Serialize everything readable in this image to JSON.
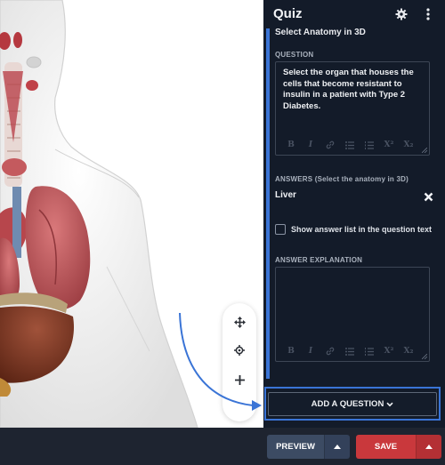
{
  "panel": {
    "title": "Quiz",
    "card_heading": "Select Anatomy in 3D",
    "question_label": "QUESTION",
    "question_text": "Select the organ that houses the cells that become resistant to insulin in a patient with Type 2 Diabetes.",
    "editor_toolbar": [
      "B",
      "I",
      "link",
      "bullets",
      "numbers",
      "X²",
      "X₂"
    ],
    "answers_label": "ANSWERS (Select the anatomy in 3D)",
    "answer": "Liver",
    "show_list_label": "Show answer list in the question text",
    "show_list_checked": false,
    "explanation_label": "ANSWER EXPLANATION",
    "explanation_text": "",
    "add_question_label": "ADD A QUESTION"
  },
  "icons": {
    "settings": "gear-icon",
    "more": "more-vertical-icon",
    "remove": "close-icon",
    "move": "move-arrows-icon",
    "focus": "target-icon",
    "zoom": "plus-icon",
    "caret": "chevron-down-icon"
  },
  "footer": {
    "preview_label": "PREVIEW",
    "save_label": "SAVE"
  },
  "colors": {
    "panel_bg": "#131b29",
    "accent": "#3a74d6",
    "save": "#c9383c",
    "preview": "#3c4b63"
  }
}
